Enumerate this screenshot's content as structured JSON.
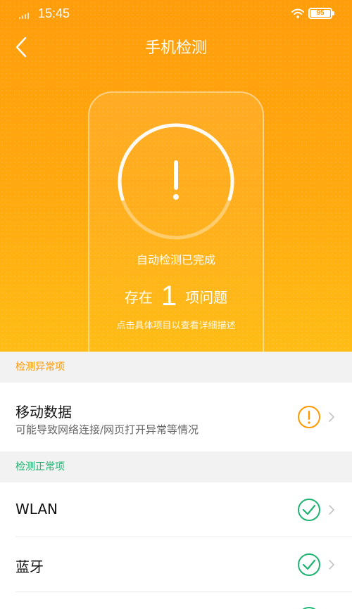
{
  "status_bar": {
    "time": "15:45",
    "battery": "95"
  },
  "header": {
    "title": "手机检测"
  },
  "summary": {
    "auto_status": "自动检测已完成",
    "prefix": "存在",
    "count": "1",
    "suffix": "项问题",
    "hint": "点击具体项目以查看详细描述"
  },
  "sections": {
    "abnormal": {
      "label": "检测异常项",
      "items": [
        {
          "title": "移动数据",
          "subtitle": "可能导致网络连接/网页打开异常等情况"
        }
      ]
    },
    "normal": {
      "label": "检测正常项",
      "items": [
        {
          "title": "WLAN"
        },
        {
          "title": "蓝牙"
        }
      ]
    }
  },
  "colors": {
    "warning": "#ff9900",
    "success": "#1fb371",
    "header_gradient_top": "#ff9d0b",
    "header_gradient_bottom": "#ffbd16"
  },
  "icons": {
    "back": "back-arrow-icon",
    "warning": "warning-circle-icon",
    "ok": "check-circle-icon",
    "chevron": "chevron-right-icon"
  }
}
